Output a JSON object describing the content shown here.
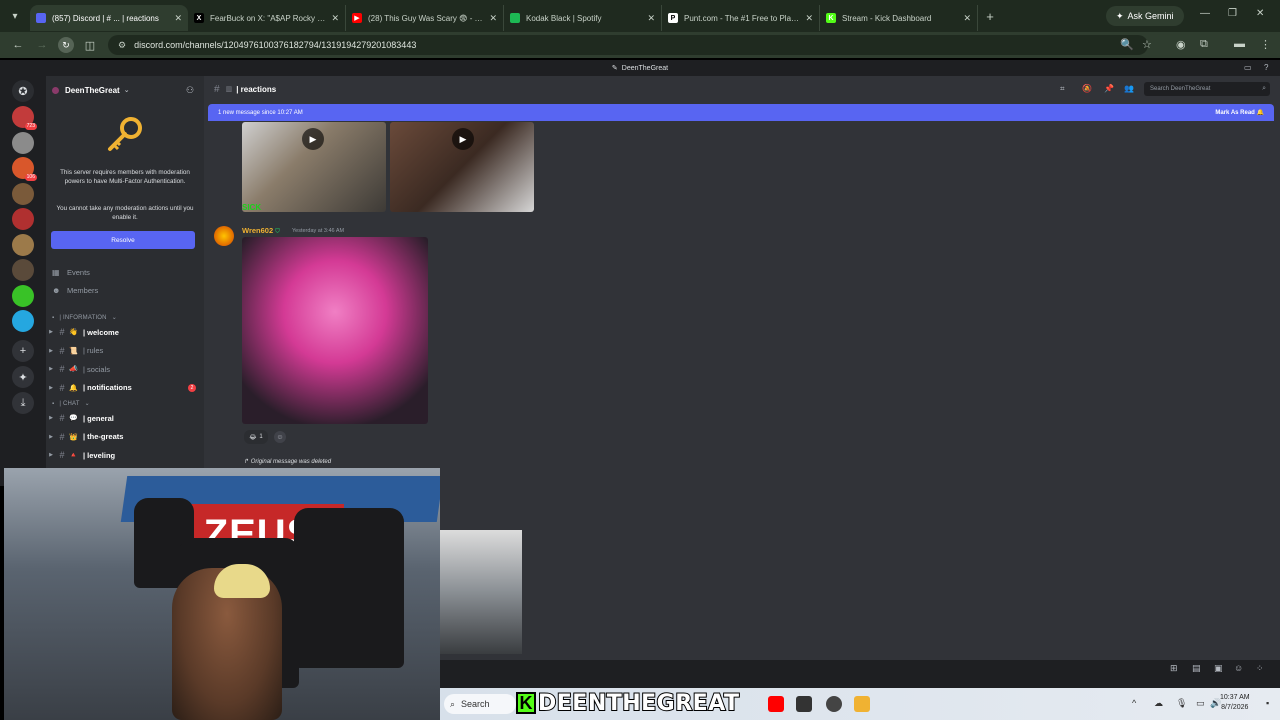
{
  "browser": {
    "tabs": [
      {
        "title": "(857) Discord | # ... | reactions",
        "favicon_color": "#5865f2",
        "favicon_glyph": "",
        "active": true
      },
      {
        "title": "FearBuck on X: \"A$AP Rocky g...",
        "favicon_color": "#000000",
        "favicon_glyph": "X",
        "active": false
      },
      {
        "title": "(28) This Guy Was Scary 😨 - Yo...",
        "favicon_color": "#ff0000",
        "favicon_glyph": "▶",
        "active": false
      },
      {
        "title": "Kodak Black | Spotify",
        "favicon_color": "#1db954",
        "favicon_glyph": "",
        "active": false
      },
      {
        "title": "Punt.com - The #1 Free to Play...",
        "favicon_color": "#ffffff",
        "favicon_glyph": "P",
        "active": false
      },
      {
        "title": "Stream - Kick Dashboard",
        "favicon_color": "#53fc18",
        "favicon_glyph": "K",
        "active": false
      }
    ],
    "new_tab_glyph": "+",
    "gemini_label": "Ask Gemini",
    "url": "discord.com/channels/1204976100376182794/1319194279201083443"
  },
  "discord": {
    "window_title": "DeenTheGreat",
    "server_name": "DeenTheGreat",
    "guild_colors": [
      "#c23b3b",
      "#8b8b8b",
      "#d9572b",
      "#7a5a3a",
      "#b03030",
      "#9c7a4a",
      "#5a4a3a",
      "#39c227",
      "#25a7e0"
    ],
    "guild_badges": [
      "723",
      "",
      "106",
      "",
      "",
      "",
      "",
      "",
      ""
    ],
    "mfa": {
      "message": "This server requires members with moderation powers to have Multi-Factor Authentication.",
      "warning": "You cannot take any moderation actions until you enable it.",
      "button_label": "Resolve"
    },
    "links": [
      {
        "label": "Events",
        "icon": "calendar-icon"
      },
      {
        "label": "Members",
        "icon": "members-icon"
      }
    ],
    "categories": [
      {
        "label": "| INFORMATION",
        "channels": [
          {
            "emoji": "👋",
            "name": "| welcome",
            "unread": true,
            "mention": ""
          },
          {
            "emoji": "📜",
            "name": "| rules",
            "unread": false,
            "mention": ""
          },
          {
            "emoji": "📣",
            "name": "| socials",
            "unread": false,
            "mention": ""
          },
          {
            "emoji": "🔔",
            "name": "| notifications",
            "unread": true,
            "mention": "2"
          }
        ]
      },
      {
        "label": "| CHAT",
        "channels": [
          {
            "emoji": "💬",
            "name": "| general",
            "unread": true,
            "mention": ""
          },
          {
            "emoji": "👑",
            "name": "| the-greats",
            "unread": true,
            "mention": ""
          },
          {
            "emoji": "🔺",
            "name": "| leveling",
            "unread": true,
            "mention": ""
          }
        ]
      }
    ],
    "channel_name": "| reactions",
    "search_placeholder": "Search DeenTheGreat",
    "new_messages_text": "1 new message since 10:27 AM",
    "mark_as_read": "Mark As Read",
    "message": {
      "author": "Wren602",
      "timestamp": "Yesterday at 3:46 AM",
      "reaction_count": "1",
      "deleted_notice": "Original message was deleted"
    },
    "media_caption": "SICK"
  },
  "stream": {
    "webcam_banner": "ZEUS",
    "kick_letter": "K",
    "streamer_name": "DEENTHEGREAT"
  },
  "taskbar": {
    "search_label": "Search",
    "time": "10:37 AM",
    "date": "8/7/2026"
  }
}
